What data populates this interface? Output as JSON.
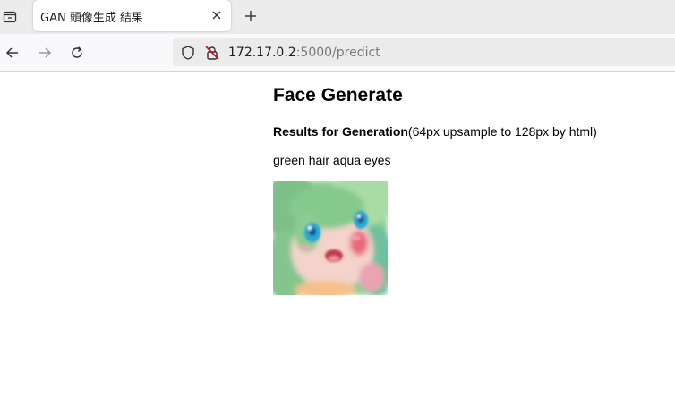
{
  "browser": {
    "tab_title": "GAN 頭像生成 結果",
    "url_host": "172.17.0.2",
    "url_rest": ":5000/predict"
  },
  "page": {
    "heading": "Face Generate",
    "results_bold": "Results for Generation",
    "results_rest": "(64px upsample to 128px by html)",
    "query_text": "green hair aqua eyes"
  },
  "icons": {
    "tab_list": "tab-list-icon",
    "close": "close-icon",
    "new_tab": "plus-icon",
    "back": "back-arrow-icon",
    "forward": "forward-arrow-icon",
    "reload": "reload-icon",
    "shield": "shield-icon",
    "insecure_lock": "insecure-lock-icon"
  },
  "colors": {
    "tabbar_bg": "#ececec",
    "navbar_bg": "#f9f9fb",
    "urlbar_bg": "#ebebeb",
    "insecure_red": "#d70022"
  }
}
